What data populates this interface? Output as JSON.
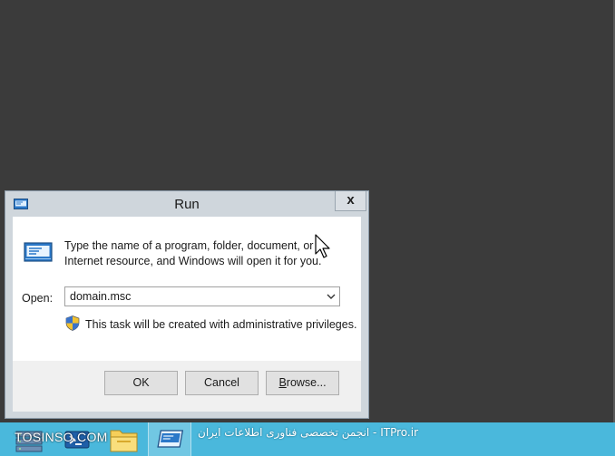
{
  "window": {
    "title": "Run",
    "close_label": "x"
  },
  "dialog": {
    "message": "Type the name of a program, folder, document, or Internet resource, and Windows will open it for you.",
    "open_label": "Open:",
    "open_value": "domain.msc",
    "admin_note": "This task will be created with administrative privileges."
  },
  "buttons": {
    "ok": "OK",
    "cancel": "Cancel",
    "browse": "Browse..."
  },
  "taskbar": {
    "items": [
      "server-manager-icon",
      "powershell-icon",
      "file-explorer-icon",
      "run-icon"
    ]
  },
  "watermark": {
    "left": "TOSINSO.COM",
    "right": "ITPro.ir - انجمن تخصصی فناوری اطلاعات ایران"
  },
  "colors": {
    "desktop": "#3b3b3b",
    "taskbar": "#4ab8dc",
    "window_frame": "#cfd6dc"
  }
}
